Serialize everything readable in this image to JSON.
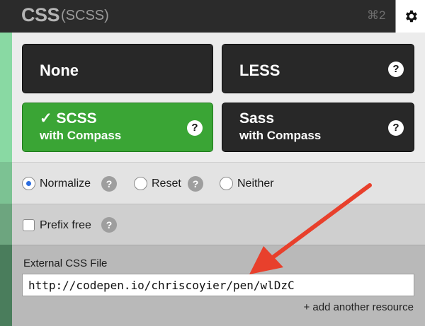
{
  "header": {
    "title": "CSS",
    "subtitle": "(SCSS)",
    "shortcut": "⌘2",
    "settings_icon": "gear-icon"
  },
  "preprocessors": {
    "none_label": "None",
    "less_label": "LESS",
    "scss_label": "SCSS",
    "scss_sub": "with Compass",
    "scss_check": "✓",
    "sass_label": "Sass",
    "sass_sub": "with Compass",
    "help_glyph": "?",
    "selected": "SCSS",
    "selected_color": "#3aa535"
  },
  "reset_options": {
    "normalize_label": "Normalize",
    "reset_label": "Reset",
    "neither_label": "Neither",
    "selected": "Normalize",
    "help_glyph": "?"
  },
  "prefix": {
    "label": "Prefix free",
    "checked": false,
    "help_glyph": "?"
  },
  "external": {
    "label": "External CSS File",
    "value": "http://codepen.io/chriscoyier/pen/wlDzC",
    "add_link": "+ add another resource"
  },
  "annotation": {
    "arrow_color": "#e8402c"
  }
}
